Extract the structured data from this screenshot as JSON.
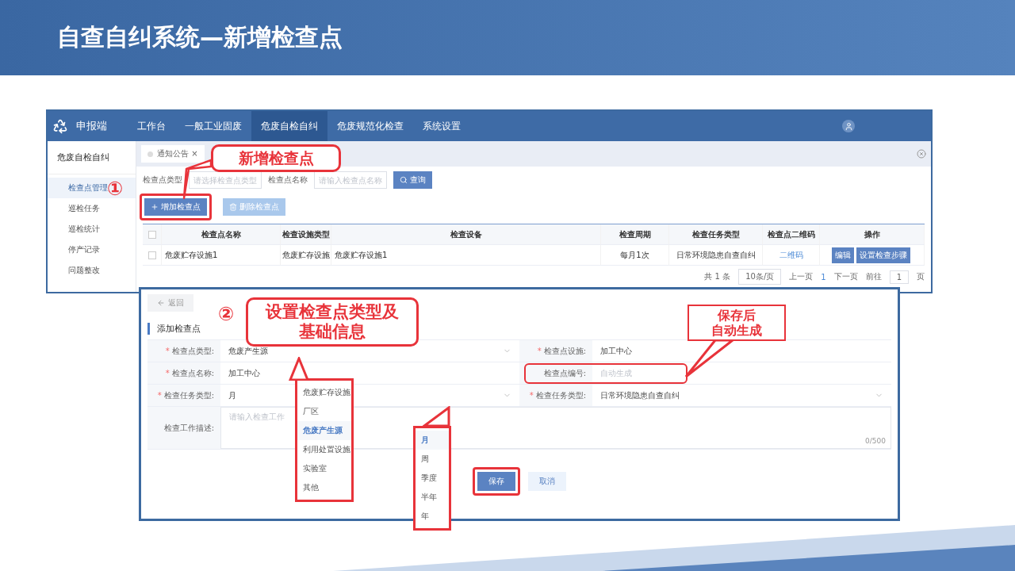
{
  "slide_title": "自查自纠系统—新增检查点",
  "app": {
    "brand": "申报端",
    "nav": [
      {
        "label": "工作台",
        "selected": false
      },
      {
        "label": "一般工业固废",
        "selected": false
      },
      {
        "label": "危废自检自纠",
        "selected": true
      },
      {
        "label": "危废规范化检查",
        "selected": false
      },
      {
        "label": "系统设置",
        "selected": false
      }
    ],
    "sidebar": {
      "title": "危废自检自纠",
      "items": [
        {
          "label": "检查点管理",
          "selected": true
        },
        {
          "label": "巡检任务",
          "selected": false
        },
        {
          "label": "巡检统计",
          "selected": false
        },
        {
          "label": "停产记录",
          "selected": false
        },
        {
          "label": "问题整改",
          "selected": false
        }
      ]
    },
    "tabs": [
      {
        "label": "通知公告",
        "close": "×"
      }
    ],
    "filters": [
      {
        "label": "检查点类型",
        "placeholder": "请选择检查点类型"
      },
      {
        "label": "检查点名称",
        "placeholder": "请输入检查点名称"
      }
    ],
    "search_button": "查询",
    "actions": [
      {
        "label": "增加检查点",
        "kind": "add",
        "disabled": false,
        "highlighted": true
      },
      {
        "label": "删除检查点",
        "kind": "delete",
        "disabled": true,
        "highlighted": false
      }
    ],
    "table": {
      "all_checked": false,
      "columns": [
        "检查点名称",
        "检查设施类型",
        "检查设备",
        "检查周期",
        "检查任务类型",
        "检查点二维码",
        "操作"
      ],
      "rows": [
        {
          "checked": false,
          "cells": [
            "危废贮存设施1",
            "危废贮存设施",
            "危废贮存设施1",
            "每月1次",
            "日常环境隐患自查自纠"
          ],
          "qr_link": "二维码",
          "buttons": [
            "编辑",
            "设置检查步骤"
          ]
        }
      ]
    },
    "pagination": {
      "total": "共 1 条",
      "page_size": "10条/页",
      "prev": "上一页",
      "page": "1",
      "next": "下一页",
      "goto_label": "前往",
      "goto_value": "1",
      "suffix": "页"
    }
  },
  "form": {
    "back": "返回",
    "title": "添加检查点",
    "required_mark": "*",
    "fields": [
      {
        "label": "检查点类型:",
        "required": true,
        "kind": "select",
        "value": "危废产生源",
        "highlighted": false
      },
      {
        "label": "检查点设施:",
        "required": true,
        "kind": "input",
        "value": "加工中心",
        "highlighted": false
      },
      {
        "label": "检查点名称:",
        "required": true,
        "kind": "input",
        "value": "加工中心",
        "highlighted": false
      },
      {
        "label": "检查点编号:",
        "required": false,
        "kind": "input",
        "placeholder": "自动生成",
        "highlighted": true
      },
      {
        "label": "检查任务类型:",
        "required": true,
        "kind": "select",
        "value": "月",
        "highlighted": false
      },
      {
        "label": "检查任务类型:",
        "required": true,
        "kind": "select",
        "value": "日常环境隐患自查自纠",
        "highlighted": false
      }
    ],
    "description": {
      "label": "检查工作描述:",
      "placeholder": "请输入检查工作",
      "counter": "0/500"
    },
    "save": "保存",
    "save_highlighted": true,
    "cancel": "取消",
    "type_options": [
      {
        "label": "危废贮存设施",
        "selected": false
      },
      {
        "label": "厂区",
        "selected": false
      },
      {
        "label": "危废产生源",
        "selected": true
      },
      {
        "label": "利用处置设施",
        "selected": false
      },
      {
        "label": "实验室",
        "selected": false
      },
      {
        "label": "其他",
        "selected": false
      }
    ],
    "period_options": [
      {
        "label": "月",
        "selected": true
      },
      {
        "label": "周",
        "selected": false
      },
      {
        "label": "季度",
        "selected": false
      },
      {
        "label": "半年",
        "selected": false
      },
      {
        "label": "年",
        "selected": false
      }
    ]
  },
  "callouts": [
    {
      "marker": "①",
      "lines": [
        "新增检查点"
      ]
    },
    {
      "marker": "②",
      "lines": [
        "设置检查点类型及",
        "基础信息"
      ]
    },
    {
      "lines": [
        "保存后",
        "自动生成"
      ]
    }
  ]
}
